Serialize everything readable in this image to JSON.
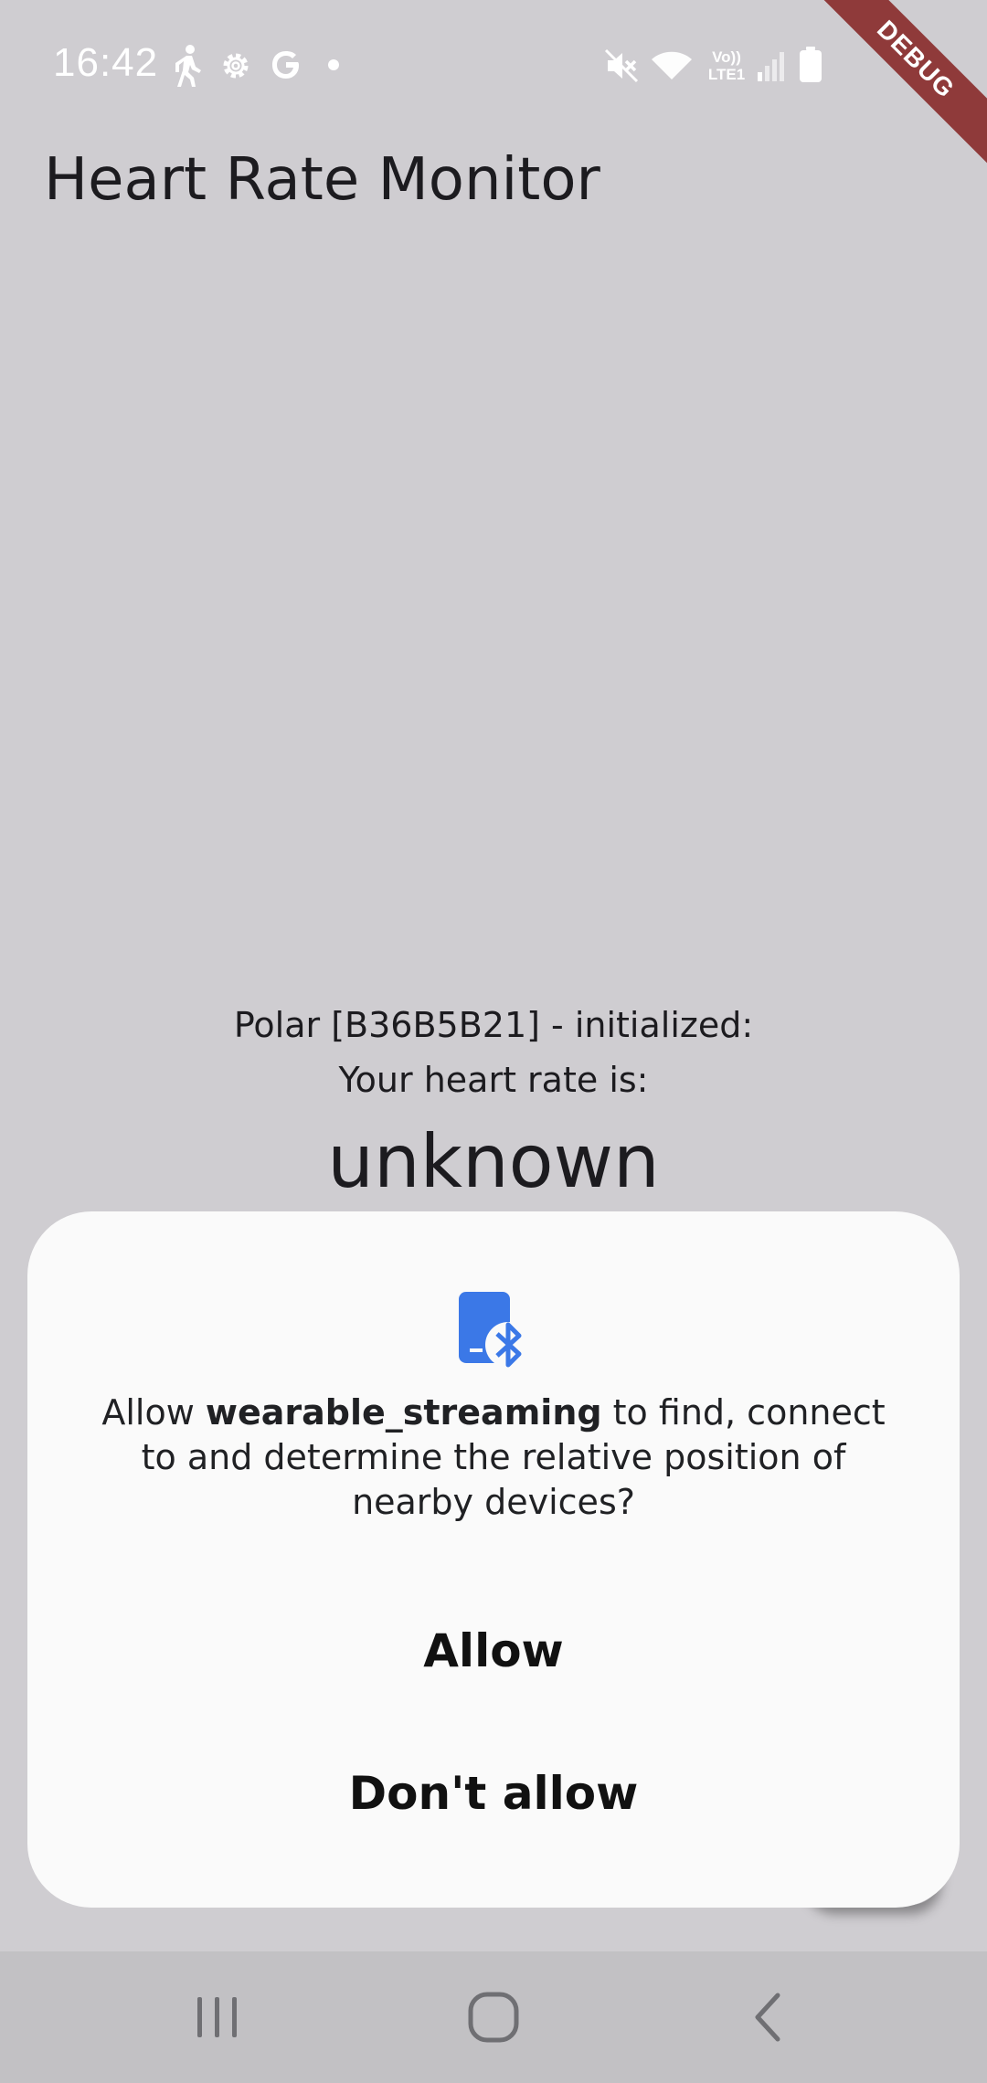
{
  "status_bar": {
    "time": "16:42",
    "icons_left": [
      "walking-icon",
      "settings-gear-icon",
      "google-icon",
      "dot-icon"
    ],
    "icons_right": [
      "mute-icon",
      "wifi-icon",
      "volte-icon",
      "signal-icon",
      "battery-icon"
    ],
    "volte_label": "Vo)) LTE1"
  },
  "debug_banner": {
    "label": "DEBUG",
    "color": "#8f3a3a"
  },
  "app_bar": {
    "title": "Heart Rate Monitor"
  },
  "main": {
    "device_status": "Polar [B36B5B21] - initialized:",
    "heart_rate_label": "Your heart rate is:",
    "heart_rate_value": "unknown"
  },
  "dialog": {
    "icon": "bluetooth-device-icon",
    "message_prefix": "Allow ",
    "app_name": "wearable_streaming",
    "message_suffix": " to find, connect to and determine the relative position of nearby devices?",
    "allow_label": "Allow",
    "deny_label": "Don't allow",
    "accent_color": "#3b78e7"
  },
  "nav_bar": {
    "buttons": [
      "recent-apps-icon",
      "home-icon",
      "back-icon"
    ]
  }
}
